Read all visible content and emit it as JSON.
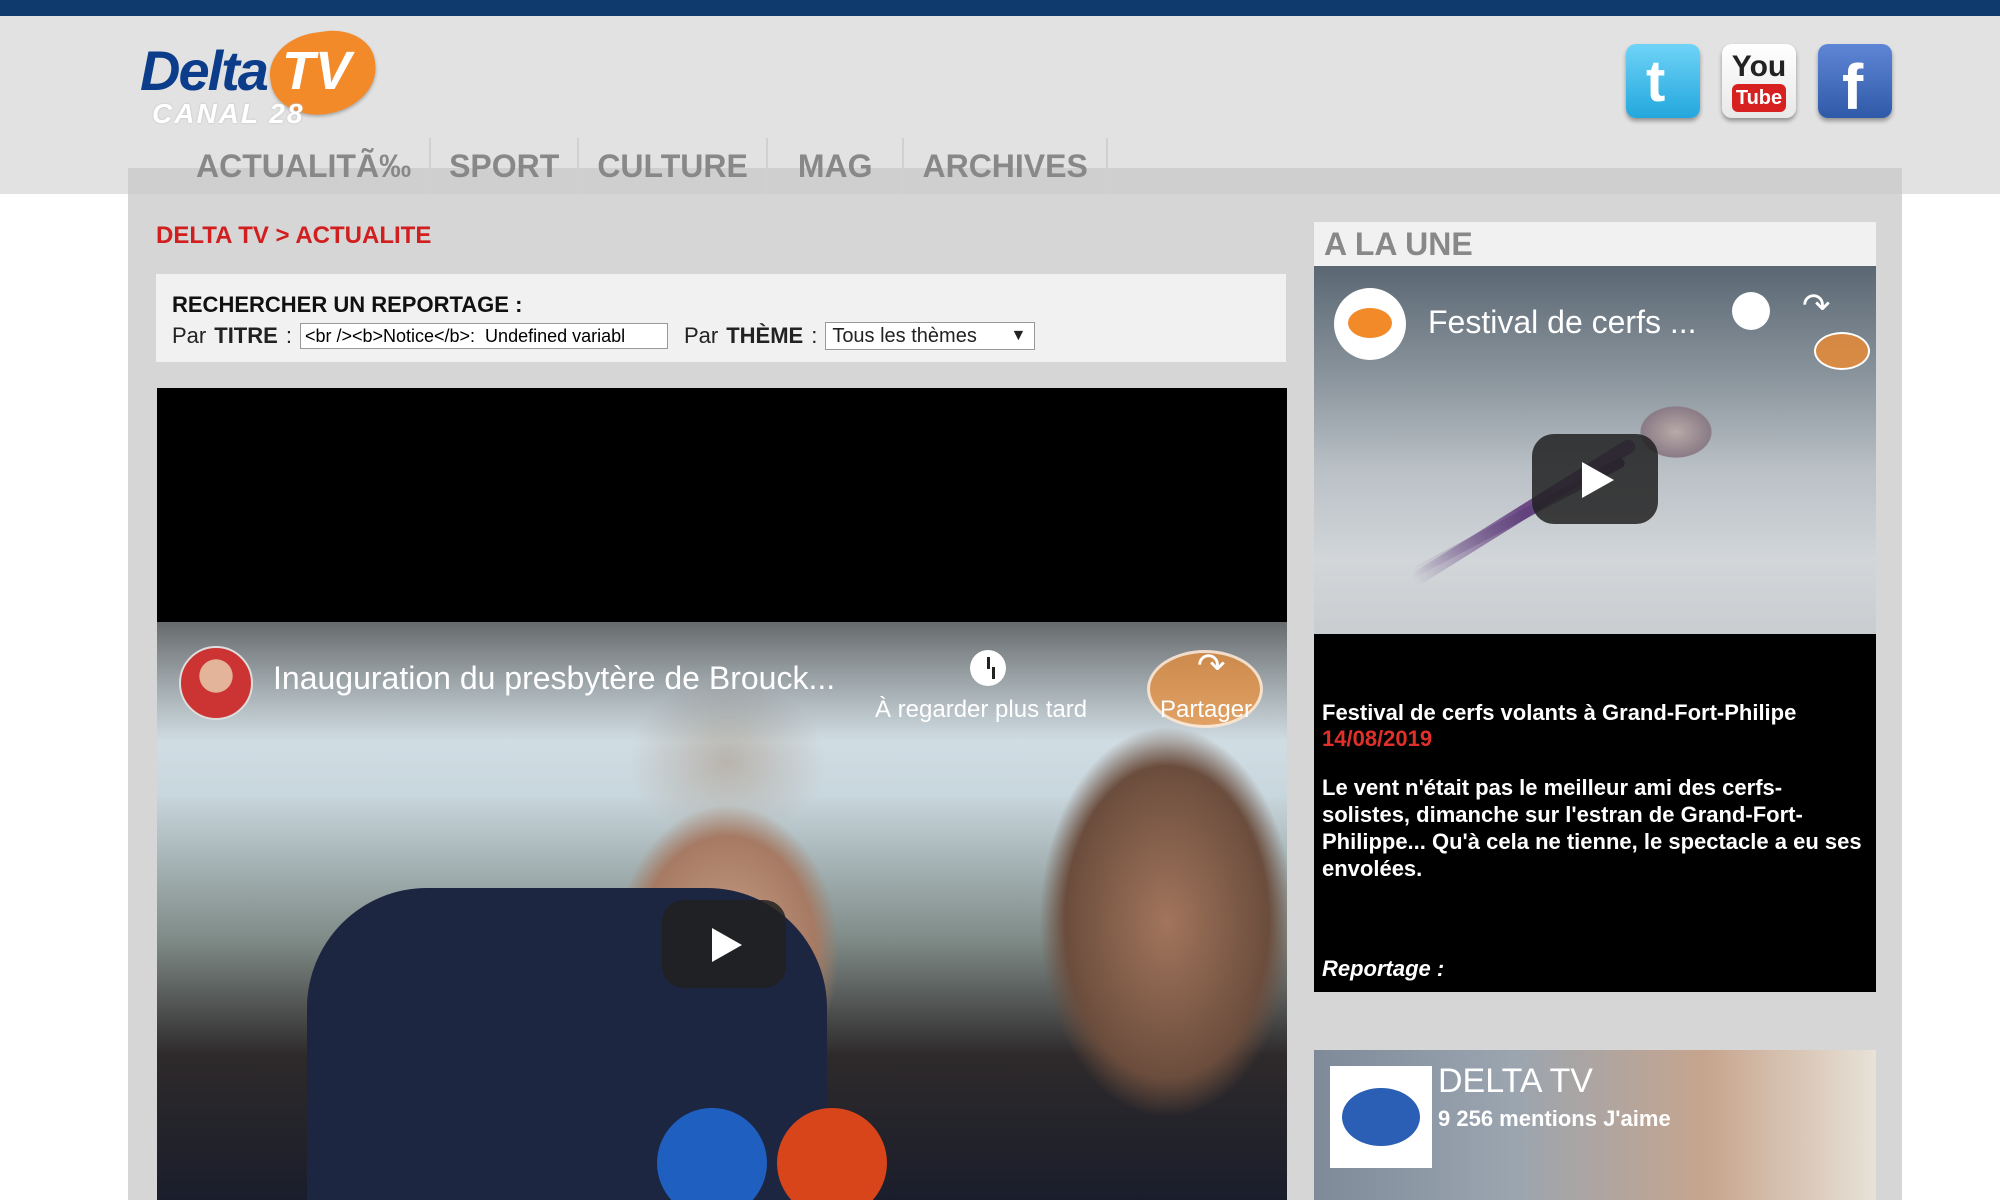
{
  "header": {
    "logo_main": "Delta",
    "logo_tv": "TV",
    "logo_sub": "CANAL 28",
    "social": {
      "twitter": "t",
      "youtube_top": "You",
      "youtube_bottom": "Tube",
      "facebook": "f"
    }
  },
  "nav": {
    "items": [
      "ACTUALITÃ‰",
      "SPORT",
      "CULTURE",
      "MAG",
      "ARCHIVES"
    ]
  },
  "breadcrumb": "DELTA TV > ACTUALITE",
  "search": {
    "title": "RECHERCHER UN REPORTAGE :",
    "title_label_prefix": "Par",
    "title_label_bold": "TITRE",
    "title_label_suffix": ":",
    "title_input_value": "<br /><b>Notice</b>:  Undefined variabl",
    "theme_label_prefix": "Par",
    "theme_label_bold": "THÈME",
    "theme_label_suffix": ":",
    "theme_selected": "Tous les thèmes",
    "dropdown_arrow": "▼"
  },
  "main_video": {
    "title": "Inauguration du presbytère de Brouck...",
    "watch_later": "À regarder plus tard",
    "share": "Partager",
    "share_icon": "↷"
  },
  "sidebar": {
    "title": "A LA UNE",
    "feature": {
      "video_title": "Festival de cerfs ...",
      "headline": "Festival de cerfs volants à Grand-Fort-Philipe",
      "date": "14/08/2019",
      "description": "Le vent n'était pas le meilleur ami des cerfs-solistes, dimanche sur l'estran de Grand-Fort-Philippe... Qu'à cela ne tienne, le spectacle a eu ses envolées.",
      "reportage_label": "Reportage :",
      "share_icon": "↷"
    },
    "facebook_widget": {
      "name": "DELTA TV",
      "likes": "9 256 mentions J'aime"
    }
  },
  "colors": {
    "top_bar": "#0e3a6e",
    "accent_red": "#d11f1f",
    "brand_orange": "#f38a2a",
    "brand_blue": "#0b3d8a"
  }
}
